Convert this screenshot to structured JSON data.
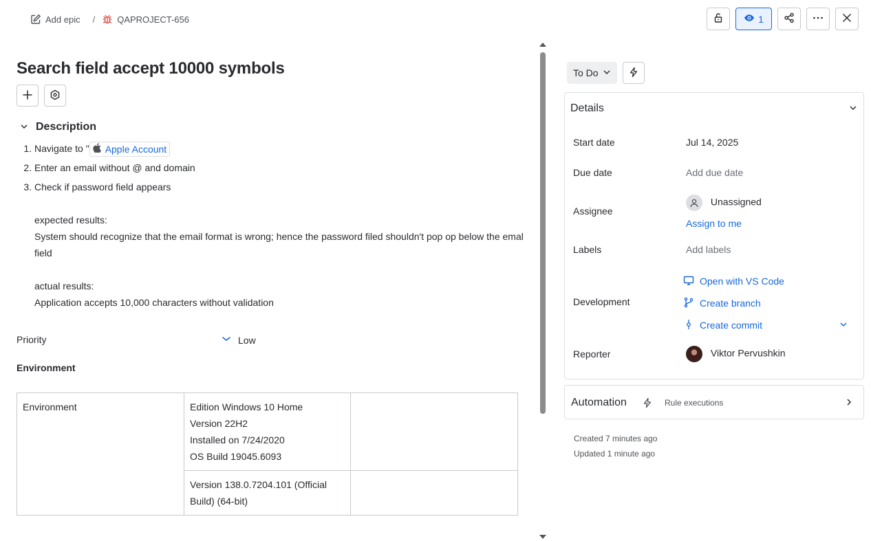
{
  "breadcrumb": {
    "epic_label": "Add epic",
    "separator": "/",
    "issue_key": "QAPROJECT-656"
  },
  "top_actions": {
    "watch_count": "1"
  },
  "issue": {
    "title": "Search field accept 10000 symbols"
  },
  "description": {
    "heading": "Description",
    "steps": [
      {
        "prefix": "Navigate to \"",
        "link_label": "Apple Account"
      },
      {
        "text": "Enter an email without @ and domain"
      },
      {
        "text": "Check if password field appears"
      }
    ],
    "expected_heading": "expected results:",
    "expected_text": "System should recognize that the email format  is wrong; hence the password filed shouldn't pop op below the emal field",
    "actual_heading": "actual results:",
    "actual_text": "Application accepts 10,000 characters without validation"
  },
  "priority": {
    "label": "Priority",
    "value": "Low"
  },
  "environment": {
    "label": "Environment",
    "table": {
      "row1_col1": "Environment",
      "row1_col2_lines": [
        "Edition Windows 10 Home",
        "Version 22H2",
        "Installed on 7/24/2020",
        "OS Build 19045.6093"
      ],
      "row2_col2_lines": [
        "Version 138.0.7204.101 (Official",
        "Build) (64-bit)"
      ]
    }
  },
  "status": {
    "value": "To Do"
  },
  "details": {
    "heading": "Details",
    "start_date_label": "Start date",
    "start_date_value": "Jul 14, 2025",
    "due_date_label": "Due date",
    "due_date_value": "Add due date",
    "assignee_label": "Assignee",
    "assignee_value": "Unassigned",
    "assign_to_me": "Assign to me",
    "labels_label": "Labels",
    "labels_value": "Add labels",
    "development_label": "Development",
    "dev_open_vscode": "Open with VS Code",
    "dev_create_branch": "Create branch",
    "dev_create_commit": "Create commit",
    "reporter_label": "Reporter",
    "reporter_value": "Viktor Pervushkin"
  },
  "automation": {
    "heading": "Automation",
    "sub": "Rule executions"
  },
  "meta": {
    "created": "Created 7 minutes ago",
    "updated": "Updated 1 minute ago"
  },
  "colors": {
    "accent": "#1868db",
    "bug_red": "#e2483d",
    "text": "#292a2e",
    "muted": "#6b6e76"
  },
  "icons": [
    "edit-icon",
    "bug-icon",
    "unlock-icon",
    "eye-icon",
    "share-icon",
    "more-icon",
    "close-icon",
    "plus-icon",
    "settings-icon",
    "chevron-down-icon",
    "apple-icon",
    "priority-low-icon",
    "lightning-icon",
    "person-icon",
    "monitor-icon",
    "branch-icon",
    "commit-icon",
    "chevron-right-icon"
  ]
}
